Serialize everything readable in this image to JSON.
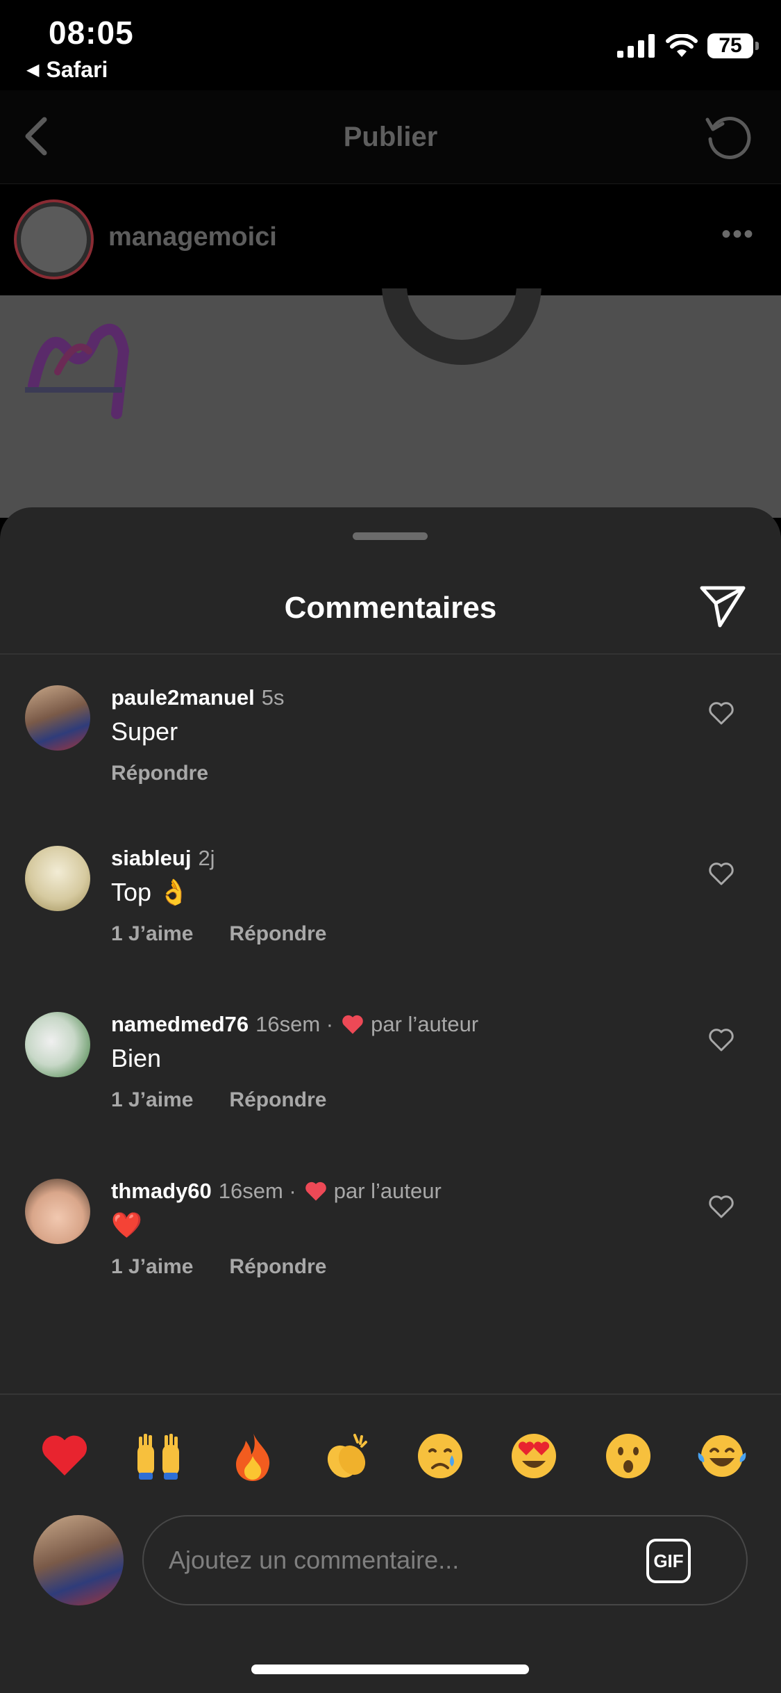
{
  "status_bar": {
    "time": "08:05",
    "back_app": "Safari",
    "battery": "75"
  },
  "header": {
    "title": "Publier"
  },
  "account": {
    "username": "managemoici"
  },
  "sheet": {
    "title": "Commentaires"
  },
  "comments": [
    {
      "username": "paule2manuel",
      "time": "5s",
      "text": "Super",
      "likes": "",
      "reply": "Répondre",
      "liked_by_author": ""
    },
    {
      "username": "siableuj",
      "time": "2j",
      "text": "Top 👌",
      "likes": "1 J’aime",
      "reply": "Répondre",
      "liked_by_author": ""
    },
    {
      "username": "namedmed76",
      "time": "16sem ·",
      "text": "Bien",
      "likes": "1 J’aime",
      "reply": "Répondre",
      "liked_by_author": "par l’auteur"
    },
    {
      "username": "thmady60",
      "time": "16sem ·",
      "text": "❤️",
      "likes": "1 J’aime",
      "reply": "Répondre",
      "liked_by_author": "par l’auteur"
    }
  ],
  "reactions": [
    "❤️",
    "🙌",
    "🔥",
    "👏",
    "😢",
    "😍",
    "😮",
    "😂"
  ],
  "composer": {
    "placeholder": "Ajoutez un commentaire...",
    "gif_label": "GIF"
  },
  "colors": {
    "sheet_bg": "#262626",
    "like_red": "#ed4956",
    "muted_text": "#a8a8a8"
  }
}
